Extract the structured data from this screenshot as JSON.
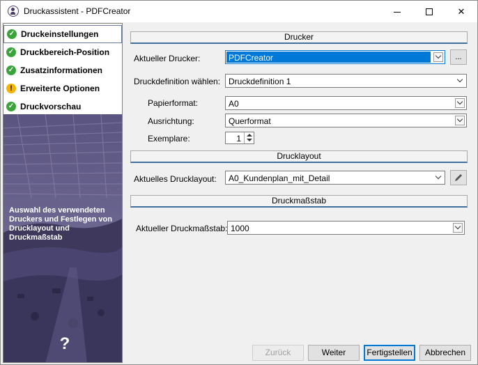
{
  "window": {
    "title": "Druckassistent - PDFCreator"
  },
  "steps": [
    {
      "label": "Druckeinstellungen",
      "status": "ok",
      "active": true
    },
    {
      "label": "Druckbereich-Position",
      "status": "ok"
    },
    {
      "label": "Zusatzinformationen",
      "status": "ok"
    },
    {
      "label": "Erweiterte Optionen",
      "status": "warning"
    },
    {
      "label": "Druckvorschau",
      "status": "ok"
    }
  ],
  "hint_text": "Auswahl des verwendeten Druckers und Festlegen von Drucklayout und Druckmaßstab",
  "sections": {
    "printer": "Drucker",
    "layout": "Drucklayout",
    "scale": "Druckmaßstab"
  },
  "fields": {
    "printer_label": "Aktueller Drucker:",
    "printer_value": "PDFCreator",
    "printer_more": "...",
    "definition_label": "Druckdefinition wählen:",
    "definition_value": "Druckdefinition 1",
    "paper_label": "Papierformat:",
    "paper_value": "A0",
    "orientation_label": "Ausrichtung:",
    "orientation_value": "Querformat",
    "copies_label": "Exemplare:",
    "copies_value": "1",
    "layout_label": "Aktuelles Drucklayout:",
    "layout_value": "A0_Kundenplan_mit_Detail",
    "scale_label": "Aktueller Druckmaßstab:",
    "scale_value": "1000"
  },
  "buttons": {
    "back": "Zurück",
    "next": "Weiter",
    "finish": "Fertigstellen",
    "cancel": "Abbrechen"
  },
  "colors": {
    "ok": "#3aa33a",
    "warning": "#f3b300",
    "panel": "#56507a",
    "accent": "#0078d7"
  }
}
